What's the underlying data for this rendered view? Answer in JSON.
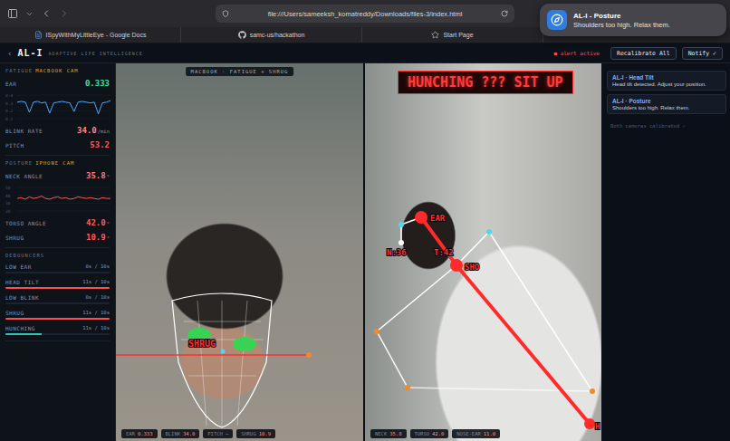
{
  "browser": {
    "url": "file:///Users/sameeksh_komatreddy/Downloads/files-3/index.html",
    "bookmarks": [
      {
        "label": "ISpyWithMyLittleEye - Google Docs",
        "kind": "doc"
      },
      {
        "label": "samc-us/hackathon",
        "kind": "github"
      },
      {
        "label": "Start Page",
        "kind": "star"
      }
    ]
  },
  "notification": {
    "title": "AL-I - Posture",
    "body": "Shoulders too high. Relax them."
  },
  "header": {
    "back": "‹",
    "logo": "AL-I",
    "tagline": "ADAPTIVE LIFE INTELLIGENCE",
    "alert": "● alert active",
    "buttons": [
      "Recalibrate All",
      "Notify ✓"
    ]
  },
  "sidebar": {
    "sections": [
      {
        "title": "FATIGUE",
        "source": "MACBOOK CAM",
        "items": [
          {
            "kind": "metric",
            "label": "EAR",
            "value": "0.333",
            "unit": "",
            "color": "#3fe0a0"
          },
          {
            "kind": "chart",
            "ticks": [
              "0.4",
              "0.3",
              "0.2",
              "0.1"
            ],
            "color": "#4aa8ff",
            "values": [
              0.31,
              0.32,
              0.31,
              0.18,
              0.31,
              0.32,
              0.3,
              0.31,
              0.17,
              0.3,
              0.31,
              0.32,
              0.31,
              0.3,
              0.19,
              0.31,
              0.32,
              0.31,
              0.3,
              0.31,
              0.16,
              0.3,
              0.31,
              0.33
            ]
          },
          {
            "kind": "metric",
            "label": "BLINK RATE",
            "value": "34.0",
            "unit": "/min",
            "color": "#ff8a8a"
          },
          {
            "kind": "metric",
            "label": "PITCH",
            "value": "53.2",
            "unit": "",
            "color": "#ff5a5a"
          }
        ]
      },
      {
        "title": "POSTURE",
        "source": "IPHONE CAM",
        "items": [
          {
            "kind": "metric",
            "label": "NECK ANGLE",
            "value": "35.8",
            "unit": "°",
            "color": "#ff7a7a"
          },
          {
            "kind": "chart",
            "ticks": [
              "50",
              "40",
              "30",
              "20"
            ],
            "color": "#ff5a5a",
            "values": [
              36,
              37,
              35,
              38,
              36,
              37,
              39,
              36,
              35,
              37,
              38,
              36,
              37,
              35,
              36,
              38,
              37,
              36,
              37,
              36,
              35,
              37,
              36,
              36
            ]
          },
          {
            "kind": "metric",
            "label": "TORSO ANGLE",
            "value": "42.0",
            "unit": "°",
            "color": "#ff5a5a"
          },
          {
            "kind": "metric",
            "label": "SHRUG",
            "value": "10.9",
            "unit": "°",
            "color": "#ff5a5a"
          }
        ]
      }
    ],
    "debouncers": {
      "title": "DEBOUNCERS",
      "rows": [
        {
          "label": "LOW EAR",
          "reading": "0s / 10s",
          "level": 0,
          "color": "#3a4456"
        },
        {
          "label": "HEAD TILT",
          "reading": "11s / 10s",
          "level": 1,
          "color": "#ff4d4d"
        },
        {
          "label": "LOW BLINK",
          "reading": "0s / 10s",
          "level": 0,
          "color": "#3a4456"
        },
        {
          "label": "SHRUG",
          "reading": "11s / 10s",
          "level": 1,
          "color": "#ff4d4d"
        },
        {
          "label": "HUNCHING",
          "reading": "11s / 10s",
          "level": 0.35,
          "color": "#2ec4b6"
        }
      ]
    }
  },
  "feeds": {
    "face": {
      "tag": "MACBOOK · FATIGUE + SHRUG",
      "label": "SHRUG",
      "stats": [
        {
          "label": "EAR",
          "value": "0.333"
        },
        {
          "label": "BLINK",
          "value": "34.0"
        },
        {
          "label": "PITCH",
          "value": "—"
        },
        {
          "label": "SHRUG",
          "value": "10.9"
        }
      ]
    },
    "pose": {
      "banner": "HUNCHING ??? SIT UP",
      "labels": [
        "EAR",
        "SHO",
        "N:36",
        "T:42",
        "H"
      ],
      "stats": [
        {
          "label": "NECK",
          "value": "35.8"
        },
        {
          "label": "TORSO",
          "value": "42.0"
        },
        {
          "label": "NOSE-EAR",
          "value": "11.0"
        }
      ]
    }
  },
  "alerts": {
    "cards": [
      {
        "title": "AL-I · Head Tilt",
        "body": "Head tilt detected. Adjust your position."
      },
      {
        "title": "AL-I · Posture",
        "body": "Shoulders too high. Relax them."
      }
    ],
    "status": "Both cameras calibrated ✓"
  }
}
